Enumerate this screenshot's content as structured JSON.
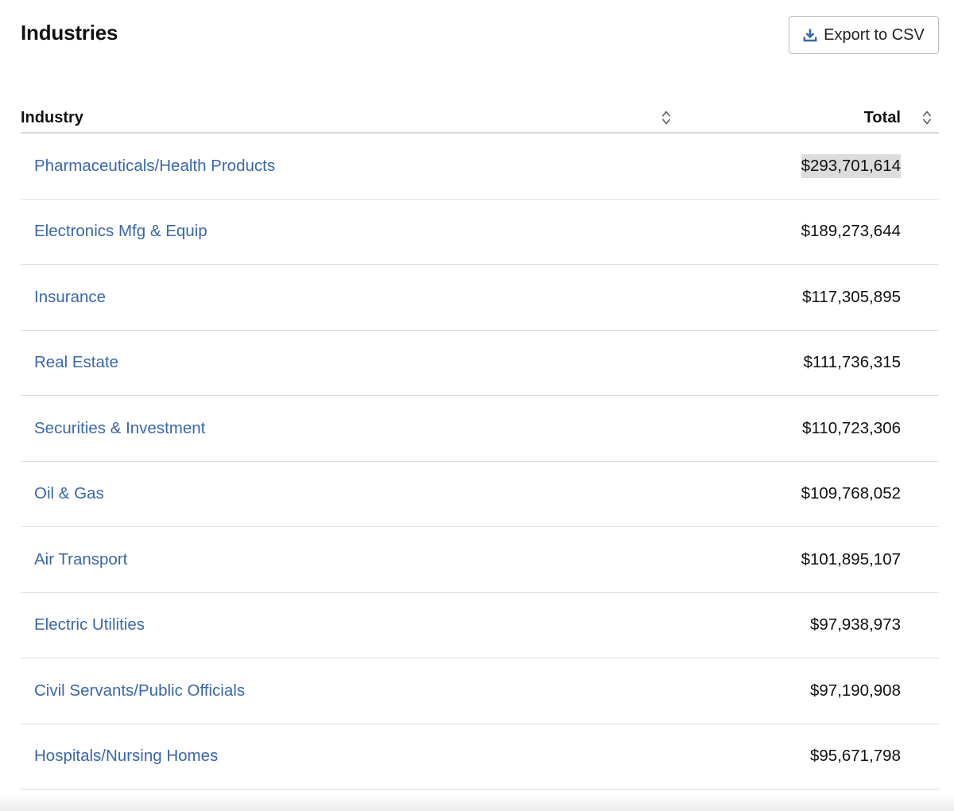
{
  "header": {
    "title": "Industries",
    "export_label": "Export to CSV",
    "export_icon": "download-icon"
  },
  "table": {
    "columns": {
      "industry": "Industry",
      "total": "Total",
      "sort_icon": "sort-icon"
    },
    "rows": [
      {
        "industry": "Pharmaceuticals/Health Products",
        "total": "$293,701,614",
        "highlighted": true
      },
      {
        "industry": "Electronics Mfg & Equip",
        "total": "$189,273,644"
      },
      {
        "industry": "Insurance",
        "total": "$117,305,895"
      },
      {
        "industry": "Real Estate",
        "total": "$111,736,315"
      },
      {
        "industry": "Securities & Investment",
        "total": "$110,723,306"
      },
      {
        "industry": "Oil & Gas",
        "total": "$109,768,052"
      },
      {
        "industry": "Air Transport",
        "total": "$101,895,107"
      },
      {
        "industry": "Electric Utilities",
        "total": "$97,938,973"
      },
      {
        "industry": "Civil Servants/Public Officials",
        "total": "$97,190,908"
      },
      {
        "industry": "Hospitals/Nursing Homes",
        "total": "$95,671,798"
      }
    ]
  },
  "colors": {
    "link": "#3a67ad",
    "highlight": "#dcdcdc",
    "border": "#dedede"
  }
}
